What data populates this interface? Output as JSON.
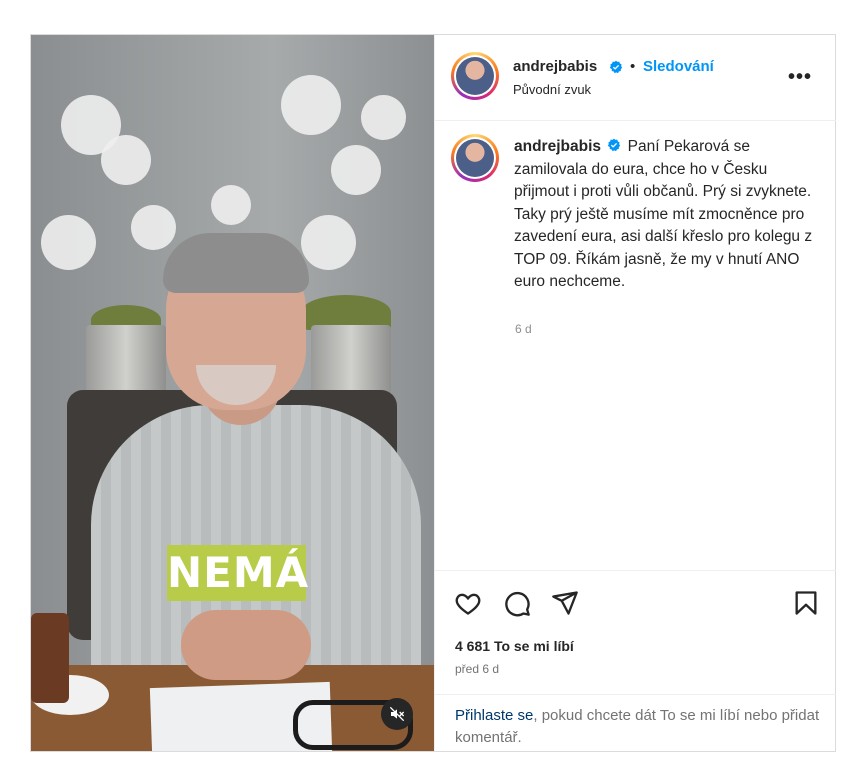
{
  "post": {
    "username": "andrejbabis",
    "follow_label": "Sledování",
    "separator": "•",
    "audio_label": "Původní zvuk",
    "more_label": "•••",
    "caption": "Paní Pekarová se zamilovala do eura, chce ho v Česku přijmout i proti vůli občanů. Prý si zvyknete. Taky prý ještě musíme mít zmocněnce pro zavedení eura, asi další křeslo pro kolegu z TOP 09. Říkám jasně, že my v hnutí ANO euro nechceme.",
    "caption_age": "6 d",
    "video_caption": "NEMÁ",
    "likes_count": "4 681",
    "likes_label": "To se mi líbí",
    "posted_ago": "před 6 d",
    "login_link": "Přihlaste se",
    "login_rest": ", pokud chcete dát To se mi líbí nebo přidat komentář."
  },
  "colors": {
    "accent": "#0095f6",
    "link": "#00376b",
    "video_caption_bg": "#b8cc4a",
    "verified": "#0095f6"
  },
  "icons": [
    "verified-badge-icon",
    "more-options-icon",
    "heart-icon",
    "comment-icon",
    "share-icon",
    "bookmark-icon",
    "speaker-muted-icon"
  ]
}
